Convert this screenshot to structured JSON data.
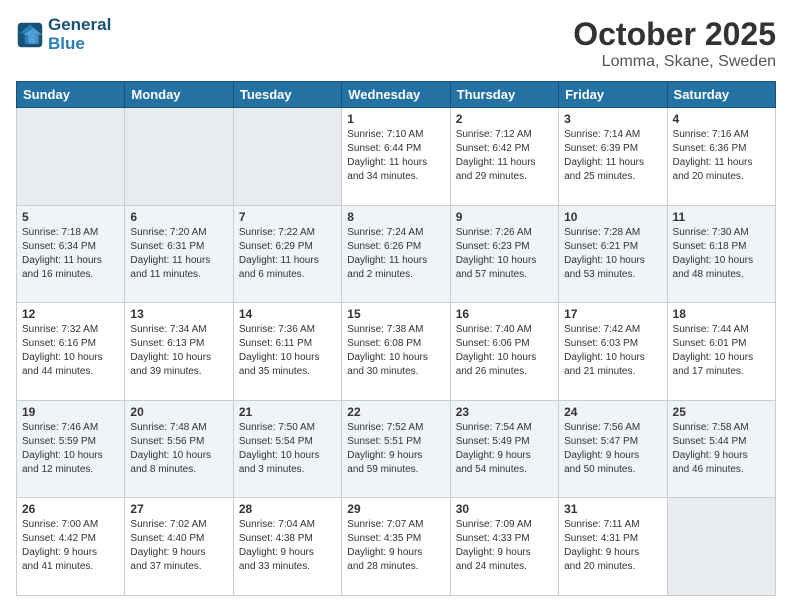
{
  "header": {
    "logo_line1": "General",
    "logo_line2": "Blue",
    "month": "October 2025",
    "location": "Lomma, Skane, Sweden"
  },
  "days_of_week": [
    "Sunday",
    "Monday",
    "Tuesday",
    "Wednesday",
    "Thursday",
    "Friday",
    "Saturday"
  ],
  "weeks": [
    [
      {
        "day": "",
        "info": ""
      },
      {
        "day": "",
        "info": ""
      },
      {
        "day": "",
        "info": ""
      },
      {
        "day": "1",
        "info": "Sunrise: 7:10 AM\nSunset: 6:44 PM\nDaylight: 11 hours\nand 34 minutes."
      },
      {
        "day": "2",
        "info": "Sunrise: 7:12 AM\nSunset: 6:42 PM\nDaylight: 11 hours\nand 29 minutes."
      },
      {
        "day": "3",
        "info": "Sunrise: 7:14 AM\nSunset: 6:39 PM\nDaylight: 11 hours\nand 25 minutes."
      },
      {
        "day": "4",
        "info": "Sunrise: 7:16 AM\nSunset: 6:36 PM\nDaylight: 11 hours\nand 20 minutes."
      }
    ],
    [
      {
        "day": "5",
        "info": "Sunrise: 7:18 AM\nSunset: 6:34 PM\nDaylight: 11 hours\nand 16 minutes."
      },
      {
        "day": "6",
        "info": "Sunrise: 7:20 AM\nSunset: 6:31 PM\nDaylight: 11 hours\nand 11 minutes."
      },
      {
        "day": "7",
        "info": "Sunrise: 7:22 AM\nSunset: 6:29 PM\nDaylight: 11 hours\nand 6 minutes."
      },
      {
        "day": "8",
        "info": "Sunrise: 7:24 AM\nSunset: 6:26 PM\nDaylight: 11 hours\nand 2 minutes."
      },
      {
        "day": "9",
        "info": "Sunrise: 7:26 AM\nSunset: 6:23 PM\nDaylight: 10 hours\nand 57 minutes."
      },
      {
        "day": "10",
        "info": "Sunrise: 7:28 AM\nSunset: 6:21 PM\nDaylight: 10 hours\nand 53 minutes."
      },
      {
        "day": "11",
        "info": "Sunrise: 7:30 AM\nSunset: 6:18 PM\nDaylight: 10 hours\nand 48 minutes."
      }
    ],
    [
      {
        "day": "12",
        "info": "Sunrise: 7:32 AM\nSunset: 6:16 PM\nDaylight: 10 hours\nand 44 minutes."
      },
      {
        "day": "13",
        "info": "Sunrise: 7:34 AM\nSunset: 6:13 PM\nDaylight: 10 hours\nand 39 minutes."
      },
      {
        "day": "14",
        "info": "Sunrise: 7:36 AM\nSunset: 6:11 PM\nDaylight: 10 hours\nand 35 minutes."
      },
      {
        "day": "15",
        "info": "Sunrise: 7:38 AM\nSunset: 6:08 PM\nDaylight: 10 hours\nand 30 minutes."
      },
      {
        "day": "16",
        "info": "Sunrise: 7:40 AM\nSunset: 6:06 PM\nDaylight: 10 hours\nand 26 minutes."
      },
      {
        "day": "17",
        "info": "Sunrise: 7:42 AM\nSunset: 6:03 PM\nDaylight: 10 hours\nand 21 minutes."
      },
      {
        "day": "18",
        "info": "Sunrise: 7:44 AM\nSunset: 6:01 PM\nDaylight: 10 hours\nand 17 minutes."
      }
    ],
    [
      {
        "day": "19",
        "info": "Sunrise: 7:46 AM\nSunset: 5:59 PM\nDaylight: 10 hours\nand 12 minutes."
      },
      {
        "day": "20",
        "info": "Sunrise: 7:48 AM\nSunset: 5:56 PM\nDaylight: 10 hours\nand 8 minutes."
      },
      {
        "day": "21",
        "info": "Sunrise: 7:50 AM\nSunset: 5:54 PM\nDaylight: 10 hours\nand 3 minutes."
      },
      {
        "day": "22",
        "info": "Sunrise: 7:52 AM\nSunset: 5:51 PM\nDaylight: 9 hours\nand 59 minutes."
      },
      {
        "day": "23",
        "info": "Sunrise: 7:54 AM\nSunset: 5:49 PM\nDaylight: 9 hours\nand 54 minutes."
      },
      {
        "day": "24",
        "info": "Sunrise: 7:56 AM\nSunset: 5:47 PM\nDaylight: 9 hours\nand 50 minutes."
      },
      {
        "day": "25",
        "info": "Sunrise: 7:58 AM\nSunset: 5:44 PM\nDaylight: 9 hours\nand 46 minutes."
      }
    ],
    [
      {
        "day": "26",
        "info": "Sunrise: 7:00 AM\nSunset: 4:42 PM\nDaylight: 9 hours\nand 41 minutes."
      },
      {
        "day": "27",
        "info": "Sunrise: 7:02 AM\nSunset: 4:40 PM\nDaylight: 9 hours\nand 37 minutes."
      },
      {
        "day": "28",
        "info": "Sunrise: 7:04 AM\nSunset: 4:38 PM\nDaylight: 9 hours\nand 33 minutes."
      },
      {
        "day": "29",
        "info": "Sunrise: 7:07 AM\nSunset: 4:35 PM\nDaylight: 9 hours\nand 28 minutes."
      },
      {
        "day": "30",
        "info": "Sunrise: 7:09 AM\nSunset: 4:33 PM\nDaylight: 9 hours\nand 24 minutes."
      },
      {
        "day": "31",
        "info": "Sunrise: 7:11 AM\nSunset: 4:31 PM\nDaylight: 9 hours\nand 20 minutes."
      },
      {
        "day": "",
        "info": ""
      }
    ]
  ]
}
